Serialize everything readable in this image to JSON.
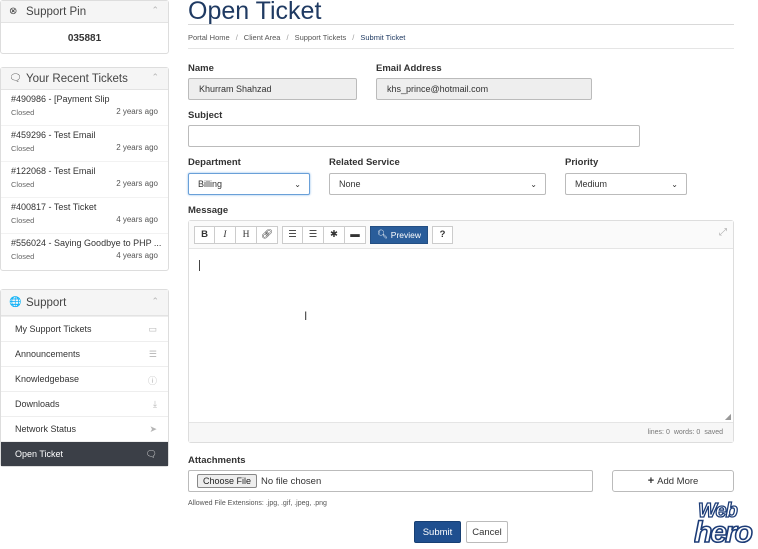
{
  "sidebar": {
    "support_pin": {
      "title": "Support Pin",
      "icon": "times-circle-icon",
      "value": "035881"
    },
    "recent_tickets": {
      "title": "Your Recent Tickets",
      "icon": "comments-icon",
      "items": [
        {
          "title": "#490986 - [Payment Slip",
          "status": "Closed",
          "age": "2 years ago"
        },
        {
          "title": "#459296 - Test Email",
          "status": "Closed",
          "age": "2 years ago"
        },
        {
          "title": "#122068 - Test Email",
          "status": "Closed",
          "age": "2 years ago"
        },
        {
          "title": "#400817 - Test Ticket",
          "status": "Closed",
          "age": "4 years ago"
        },
        {
          "title": "#556024 - Saying Goodbye to PHP ...",
          "status": "Closed",
          "age": "4 years ago"
        }
      ]
    },
    "support": {
      "title": "Support",
      "icon": "globe-icon",
      "items": [
        {
          "label": "My Support Tickets",
          "icon": "ticket-icon"
        },
        {
          "label": "Announcements",
          "icon": "list-icon"
        },
        {
          "label": "Knowledgebase",
          "icon": "info-circle-icon"
        },
        {
          "label": "Downloads",
          "icon": "download-icon"
        },
        {
          "label": "Network Status",
          "icon": "rocket-icon"
        },
        {
          "label": "Open Ticket",
          "icon": "comments-icon",
          "active": true
        }
      ]
    }
  },
  "main": {
    "title": "Open Ticket",
    "breadcrumb": [
      "Portal Home",
      "Client Area",
      "Support Tickets",
      "Submit Ticket"
    ],
    "form": {
      "name_label": "Name",
      "name_value": "Khurram Shahzad",
      "email_label": "Email Address",
      "email_value": "khs_prince@hotmail.com",
      "subject_label": "Subject",
      "subject_value": "",
      "department_label": "Department",
      "department_value": "Billing",
      "related_label": "Related Service",
      "related_value": "None",
      "priority_label": "Priority",
      "priority_value": "Medium",
      "message_label": "Message",
      "toolbar": {
        "bold": "B",
        "italic": "I",
        "heading": "H",
        "preview": "Preview"
      },
      "status": {
        "lines": "lines: 0",
        "words": "words: 0",
        "saved": "saved"
      },
      "attachments_label": "Attachments",
      "choose_file": "Choose File",
      "no_file": "No file chosen",
      "add_more": "Add More",
      "allowed": "Allowed File Extensions: .jpg, .gif, .jpeg, .png",
      "submit": "Submit",
      "cancel": "Cancel"
    }
  },
  "logo": {
    "line1": "Web",
    "line2": "hero"
  },
  "colors": {
    "title": "#1f3a62",
    "primary_button": "#1f4f8f",
    "active_sidebar": "#3b3f47"
  }
}
